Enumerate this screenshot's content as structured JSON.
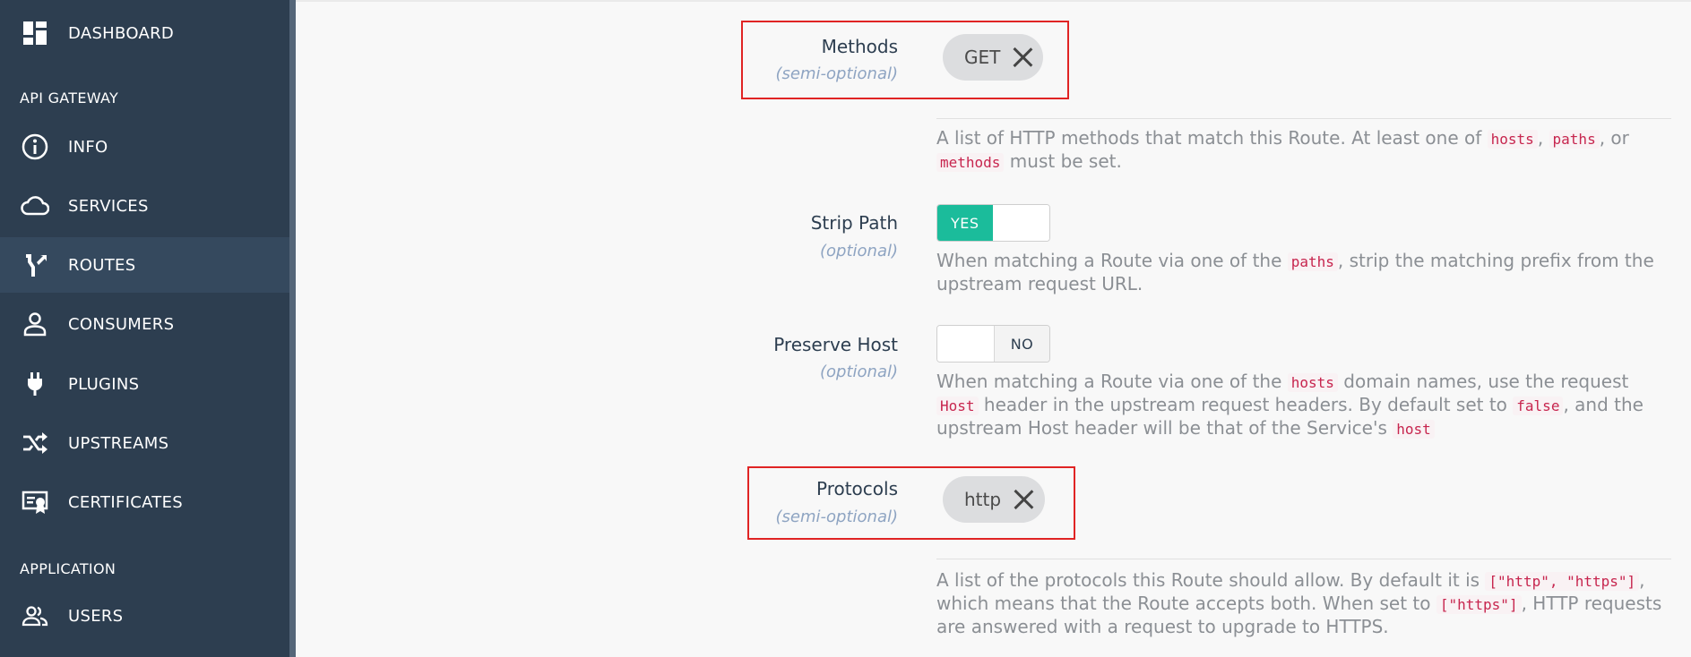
{
  "sidebar": {
    "dashboard": {
      "label": "DASHBOARD",
      "icon": "dashboard-icon"
    },
    "section_api_gateway": "API GATEWAY",
    "info": {
      "label": "INFO",
      "icon": "info-icon"
    },
    "services": {
      "label": "SERVICES",
      "icon": "cloud-icon"
    },
    "routes": {
      "label": "ROUTES",
      "icon": "routes-icon"
    },
    "consumers": {
      "label": "CONSUMERS",
      "icon": "person-icon"
    },
    "plugins": {
      "label": "PLUGINS",
      "icon": "plug-icon"
    },
    "upstreams": {
      "label": "UPSTREAMS",
      "icon": "shuffle-icon"
    },
    "certificates": {
      "label": "CERTIFICATES",
      "icon": "certificate-icon"
    },
    "section_application": "APPLICATION",
    "users": {
      "label": "USERS",
      "icon": "users-icon"
    },
    "active_item": "ROUTES"
  },
  "form": {
    "methods": {
      "label": "Methods",
      "sub": "(semi-optional)",
      "chip": "GET",
      "help_parts": [
        "A list of HTTP methods that match this Route. At least one of ",
        "hosts",
        ", ",
        "paths",
        ", or ",
        "methods",
        " must be set."
      ]
    },
    "strip_path": {
      "label": "Strip Path",
      "sub": "(optional)",
      "toggle_on_label": "YES",
      "help_parts": [
        "When matching a Route via one of the ",
        "paths",
        ", strip the matching prefix from the upstream request URL."
      ]
    },
    "preserve_host": {
      "label": "Preserve Host",
      "sub": "(optional)",
      "toggle_off_label": "NO",
      "help_parts": [
        "When matching a Route via one of the ",
        "hosts",
        " domain names, use the request ",
        "Host",
        " header in the upstream request headers. By default set to ",
        "false",
        ", and the upstream Host header will be that of the Service's ",
        "host"
      ]
    },
    "protocols": {
      "label": "Protocols",
      "sub": "(semi-optional)",
      "chip": "http",
      "help_parts": [
        "A list of the protocols this Route should allow. By default it is ",
        "[\"http\", \"https\"]",
        ", which means that the Route accepts both. When set to ",
        "[\"https\"]",
        ", HTTP requests are answered with a request to upgrade to HTTPS."
      ]
    }
  },
  "colors": {
    "sidebar_bg": "#2d3e50",
    "active_bg": "#35495e",
    "toggle_on": "#1bbc9b",
    "highlight_box": "#e02424",
    "code_text": "#c7254e"
  }
}
